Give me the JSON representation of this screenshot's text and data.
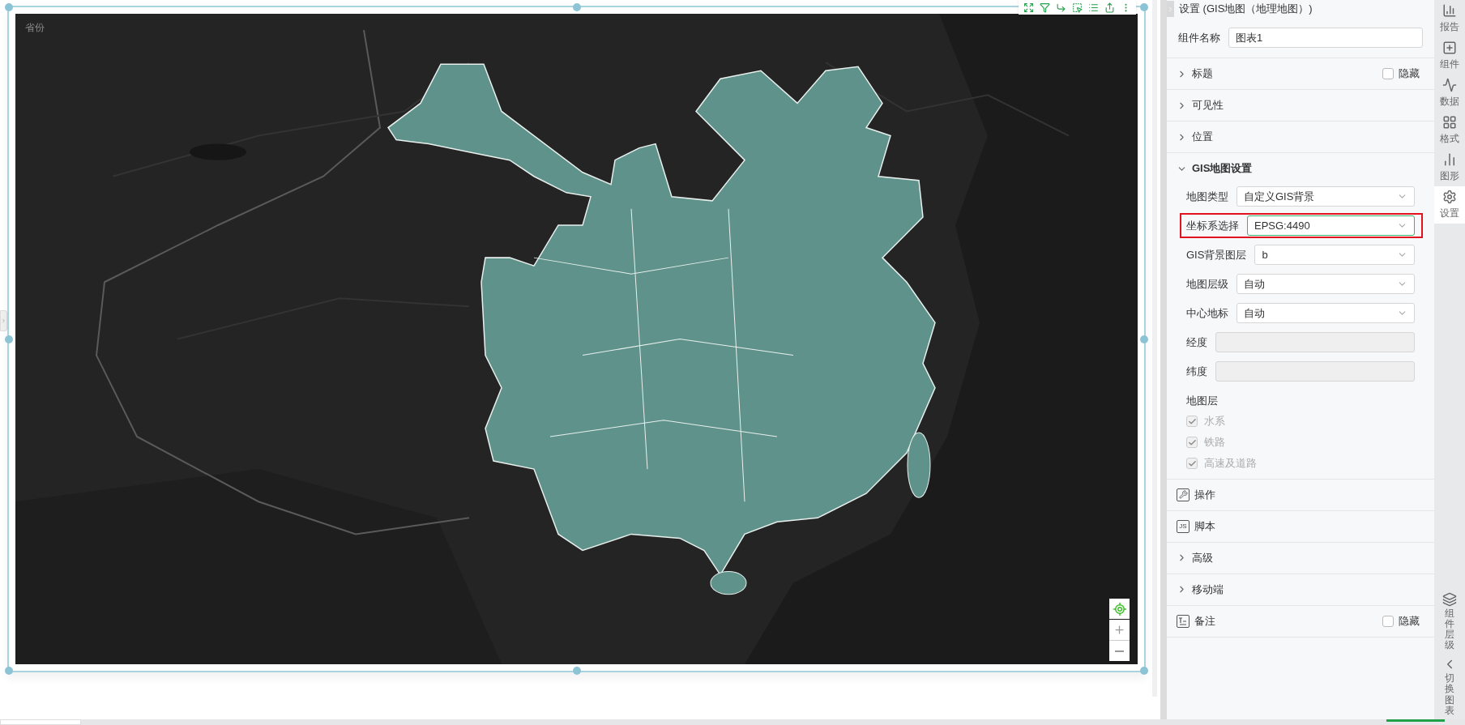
{
  "canvas": {
    "legend_title": "省份"
  },
  "panel": {
    "title": "设置 (GIS地图（地理地图）)",
    "name_label": "组件名称",
    "name_value": "图表1",
    "sections": [
      {
        "kind": "collapsible",
        "label": "标题",
        "expanded": false,
        "hide": {
          "label": "隐藏",
          "checked": false
        }
      },
      {
        "kind": "collapsible",
        "label": "可见性",
        "expanded": false
      },
      {
        "kind": "collapsible",
        "label": "位置",
        "expanded": false
      },
      {
        "kind": "collapsible",
        "label": "GIS地图设置",
        "expanded": true,
        "fields": [
          {
            "kind": "select",
            "label": "地图类型",
            "value": "自定义GIS背景",
            "highlighted": false,
            "focused": false
          },
          {
            "kind": "select",
            "label": "坐标系选择",
            "value": "EPSG:4490",
            "highlighted": true,
            "focused": true
          },
          {
            "kind": "select",
            "label": "GIS背景图层",
            "value": "b",
            "highlighted": false,
            "focused": false
          },
          {
            "kind": "select",
            "label": "地图层级",
            "value": "自动",
            "highlighted": false,
            "focused": false
          },
          {
            "kind": "select",
            "label": "中心地标",
            "value": "自动",
            "highlighted": false,
            "focused": false
          },
          {
            "kind": "input",
            "label": "经度",
            "disabled": true
          },
          {
            "kind": "input",
            "label": "纬度",
            "disabled": true
          }
        ],
        "layers_label": "地图层",
        "layers": [
          {
            "label": "水系",
            "checked": true,
            "disabled": true
          },
          {
            "label": "铁路",
            "checked": true,
            "disabled": true
          },
          {
            "label": "高速及道路",
            "checked": true,
            "disabled": true
          }
        ]
      },
      {
        "kind": "operation",
        "label": "操作"
      },
      {
        "kind": "script",
        "label": "脚本",
        "badge": "JS"
      },
      {
        "kind": "collapsible",
        "label": "高级",
        "expanded": false
      },
      {
        "kind": "collapsible",
        "label": "移动端",
        "expanded": false
      },
      {
        "kind": "note",
        "label": "备注",
        "hide": {
          "label": "隐藏",
          "checked": false
        }
      }
    ]
  },
  "rail": {
    "tabs": [
      {
        "kind": "report",
        "label": "报告",
        "selected": false
      },
      {
        "kind": "component",
        "label": "组件",
        "selected": false
      },
      {
        "kind": "data",
        "label": "数据",
        "selected": false
      },
      {
        "kind": "format",
        "label": "格式",
        "selected": false
      },
      {
        "kind": "shape",
        "label": "图形",
        "selected": false
      },
      {
        "kind": "settings",
        "label": "设置",
        "selected": true
      }
    ],
    "bottom": [
      {
        "kind": "layers",
        "label": "组件层级"
      },
      {
        "kind": "switch",
        "label": "切换图表"
      }
    ]
  }
}
